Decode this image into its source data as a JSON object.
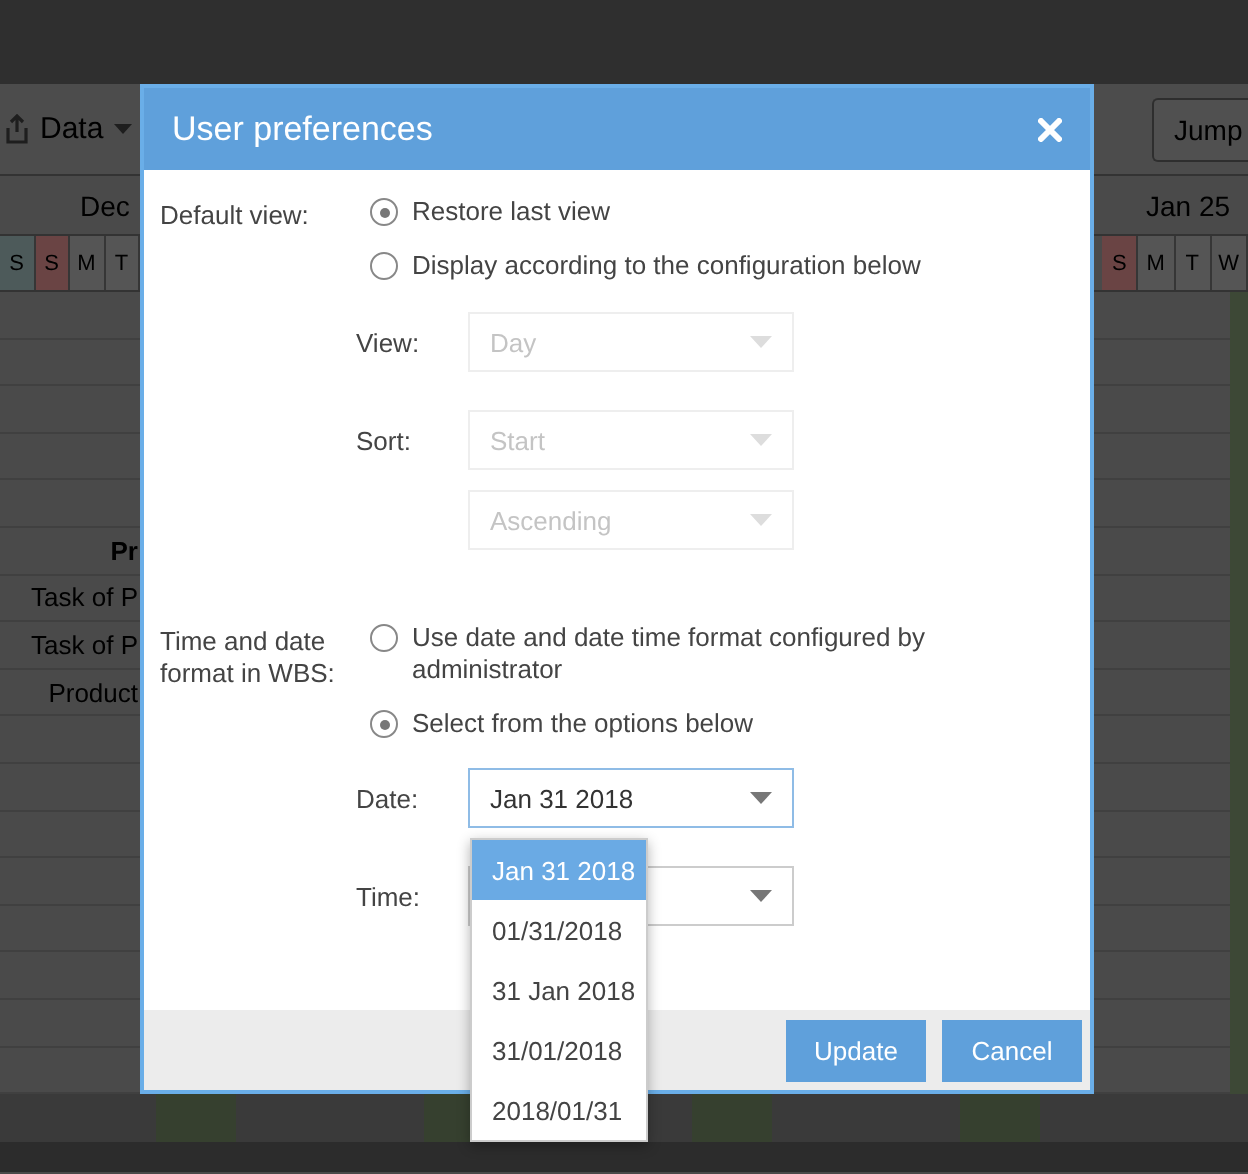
{
  "app_background": {
    "data_button": "Data",
    "jump_button": "Jump",
    "timeline_left": {
      "month": "Dec",
      "days": [
        {
          "label": "S",
          "kind": "saturday"
        },
        {
          "label": "S",
          "kind": "sunday"
        },
        {
          "label": "M",
          "kind": "weekday"
        },
        {
          "label": "T",
          "kind": "weekday"
        }
      ]
    },
    "timeline_right": {
      "month": "Jan 25",
      "days": [
        {
          "label": "S",
          "kind": "sunday"
        },
        {
          "label": "M",
          "kind": "weekday"
        },
        {
          "label": "T",
          "kind": "weekday"
        },
        {
          "label": "W",
          "kind": "weekday"
        }
      ]
    },
    "tasks": [
      "Pr",
      "Task of P",
      "Task of P",
      "Product"
    ]
  },
  "dialog": {
    "title": "User preferences",
    "default_view": {
      "label": "Default view:",
      "options": [
        {
          "label": "Restore last view",
          "selected": true
        },
        {
          "label": "Display according to the configuration below",
          "selected": false
        }
      ],
      "view_select": {
        "label": "View:",
        "value": "Day",
        "disabled": true
      },
      "sort_select": {
        "label": "Sort:",
        "value": "Start",
        "disabled": true
      },
      "order_select": {
        "value": "Ascending",
        "disabled": true
      }
    },
    "date_format": {
      "label": "Time and date format in WBS:",
      "options": [
        {
          "label": "Use date and date time format configured by administrator",
          "selected": false
        },
        {
          "label": "Select from the options below",
          "selected": true
        }
      ],
      "date_select": {
        "label": "Date:",
        "value": "Jan 31 2018",
        "disabled": false,
        "focused": true
      },
      "time_select": {
        "label": "Time:",
        "disabled": false,
        "focused": false
      },
      "date_dropdown": [
        {
          "label": "Jan 31 2018",
          "selected": true
        },
        {
          "label": "01/31/2018",
          "selected": false
        },
        {
          "label": "31 Jan 2018",
          "selected": false
        },
        {
          "label": "31/01/2018",
          "selected": false
        },
        {
          "label": "2018/01/31",
          "selected": false
        }
      ]
    },
    "buttons": [
      "Update",
      "Cancel"
    ]
  }
}
